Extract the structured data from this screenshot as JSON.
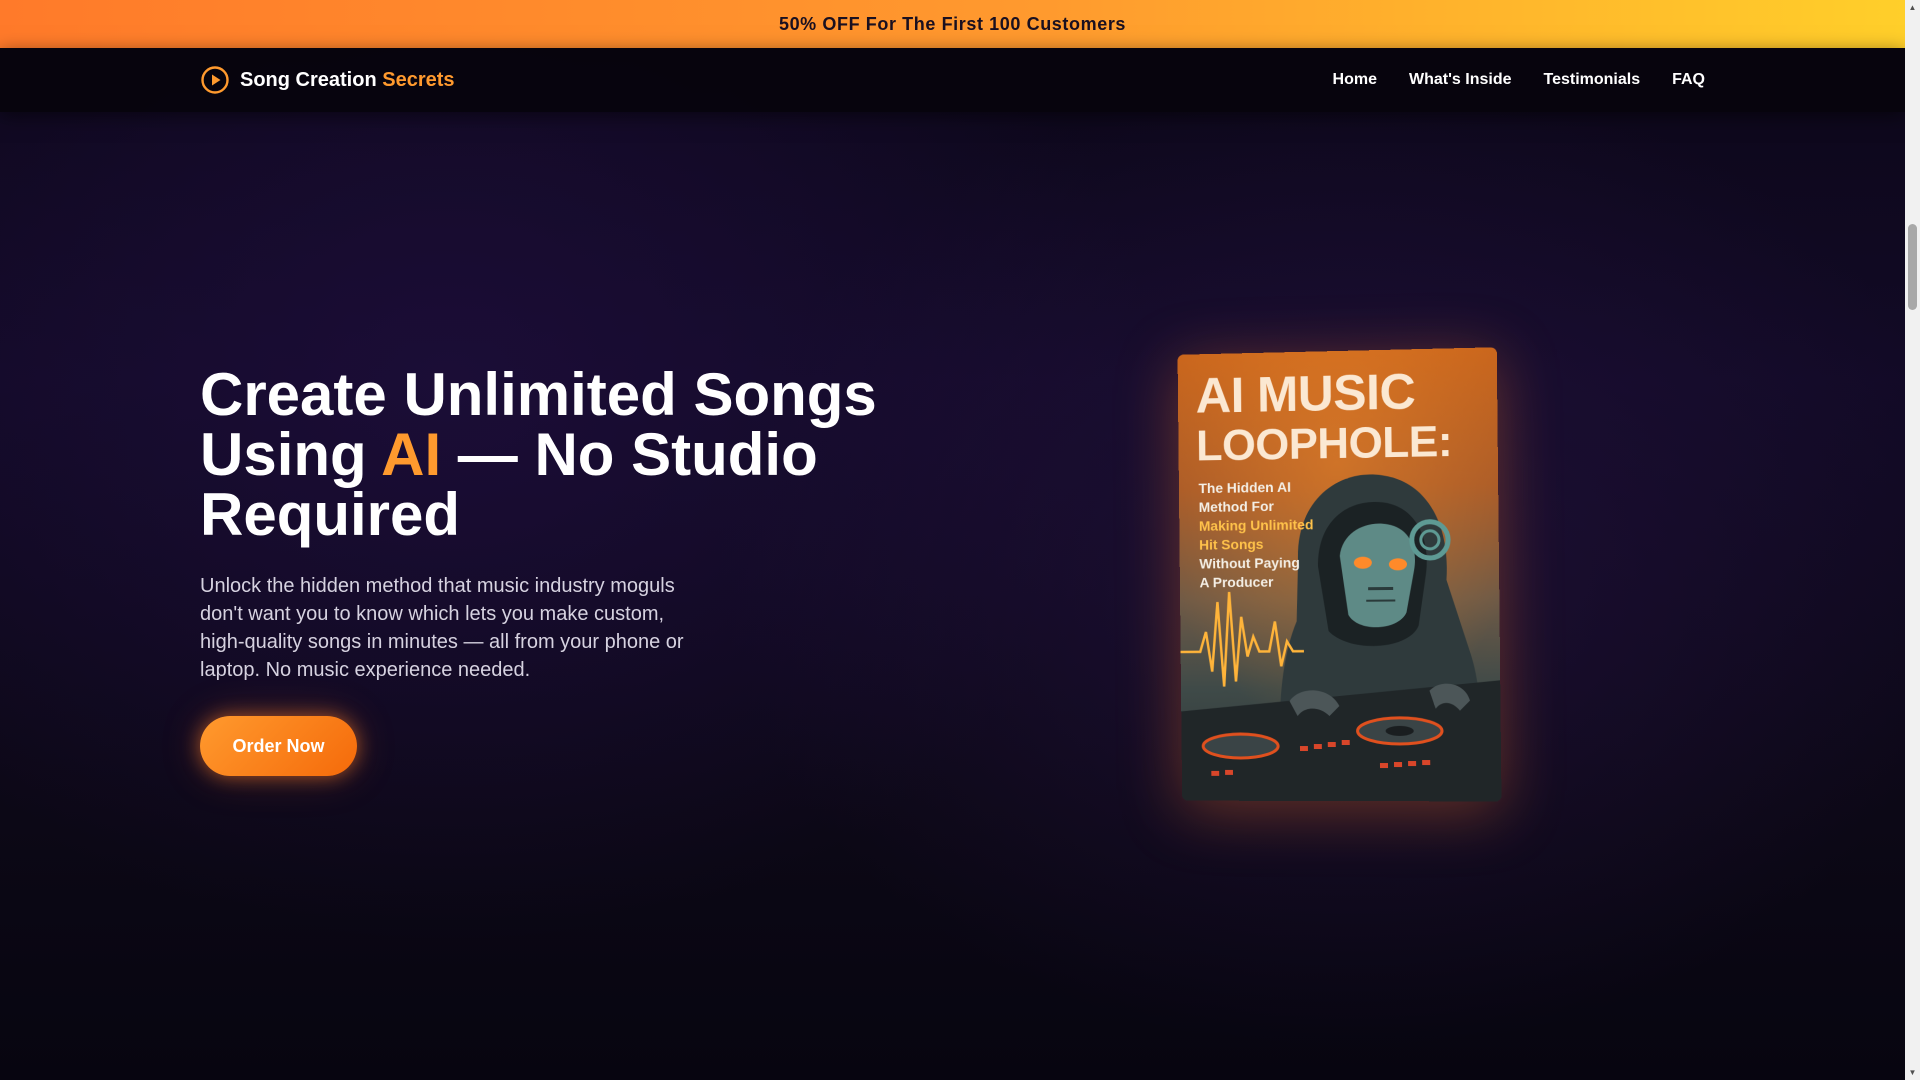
{
  "promo": {
    "text": "50% OFF For The First 100 Customers"
  },
  "brand": {
    "name_main": "Song Creation",
    "name_accent": "Secrets",
    "icon": "play-circle-icon"
  },
  "nav": {
    "items": [
      {
        "label": "Home"
      },
      {
        "label": "What's Inside"
      },
      {
        "label": "Testimonials"
      },
      {
        "label": "FAQ"
      }
    ]
  },
  "hero": {
    "title_line1": "Create Unlimited Songs",
    "title_line2_before": "Using",
    "title_line2_accent": "AI",
    "title_line2_after": "— No Studio",
    "title_line3": "Required",
    "subtitle": "Unlock the hidden method that music industry moguls don't want you to know which lets you make custom, high-quality songs in minutes — all from your phone or laptop. No music experience needed.",
    "cta_label": "Order Now"
  },
  "book": {
    "title_line1": "AI MUSIC",
    "title_line2": "LOOPHOLE:",
    "sub_line1": "The Hidden AI",
    "sub_line2": "Method For",
    "sub_line3": "Making Unlimited",
    "sub_line4": "Hit Songs",
    "sub_line5": "Without Paying",
    "sub_line6": "A Producer",
    "art": "hooded-dj-robot-illustration"
  },
  "colors": {
    "accent": "#ff9a2e",
    "promo_start": "#ff7a2a",
    "promo_end": "#ffcf2a",
    "background": "#0c0718"
  }
}
